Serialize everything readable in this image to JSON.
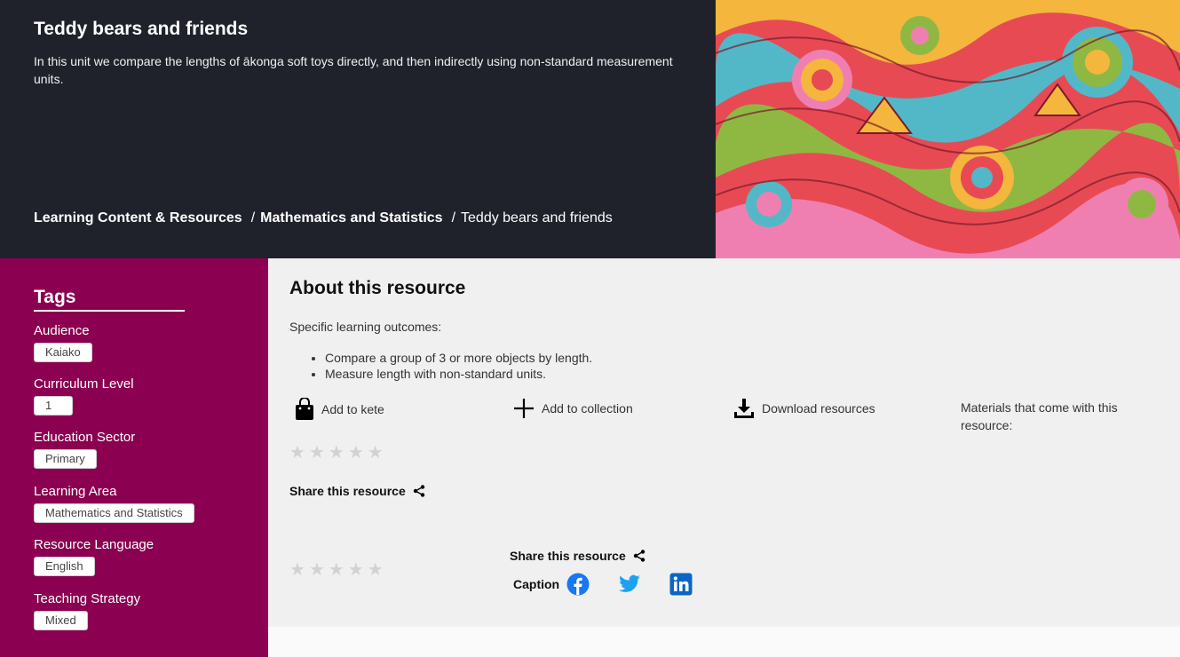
{
  "hero": {
    "title": "Teddy bears and friends",
    "description": "In this unit we compare the lengths of ākonga soft toys directly, and then indirectly using non-standard measurement units.",
    "breadcrumb": [
      "Learning Content & Resources",
      "Mathematics and Statistics",
      "Teddy bears and friends"
    ],
    "separator": "/"
  },
  "tags": {
    "title": "Tags",
    "groups": [
      {
        "label": "Audience",
        "value": "Kaiako"
      },
      {
        "label": "Curriculum Level",
        "value": "1"
      },
      {
        "label": "Education Sector",
        "value": "Primary"
      },
      {
        "label": "Learning Area",
        "value": "Mathematics and Statistics"
      },
      {
        "label": "Resource Language",
        "value": "English"
      },
      {
        "label": "Teaching Strategy",
        "value": "Mixed"
      }
    ]
  },
  "about": {
    "title": "About this resource",
    "outcomes_label": "Specific learning outcomes:",
    "outcomes": [
      "Compare a group of 3 or more objects by length.",
      "Measure length with non-standard units."
    ],
    "actions": {
      "kete": "Add to kete",
      "collection": "Add to collection",
      "download": "Download resources"
    },
    "materials": "Materials that come with this resource:",
    "share_label": "Share this resource",
    "share_label_2": "Share this resource",
    "caption": "Caption",
    "rating_top": 0,
    "rating_bottom": 0,
    "star_glyph": "★"
  },
  "colors": {
    "hero_bg": "#1f222a",
    "sidebar_bg": "#8b0050",
    "facebook": "#1877f2",
    "twitter": "#1da1f2",
    "linkedin": "#0a66c2"
  }
}
